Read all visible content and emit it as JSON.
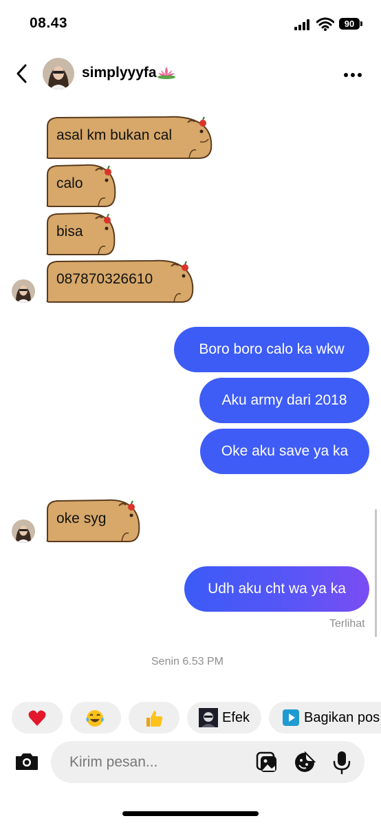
{
  "status_bar": {
    "time": "08.43",
    "battery": "90",
    "icons": [
      "cellular-signal-icon",
      "wifi-icon",
      "battery-icon"
    ]
  },
  "header": {
    "username": "simplyyyfa",
    "name_emoji": "lotus-icon",
    "icons": [
      "back-chevron-icon",
      "more-options-icon"
    ]
  },
  "messages": [
    {
      "from": "them",
      "text": "asal km bukan cal"
    },
    {
      "from": "them",
      "text": "calo"
    },
    {
      "from": "them",
      "text": "bisa"
    },
    {
      "from": "them",
      "text": "087870326610"
    },
    {
      "from": "me",
      "text": "Boro boro calo ka wkw"
    },
    {
      "from": "me",
      "text": "Aku army dari 2018"
    },
    {
      "from": "me",
      "text": "Oke aku save ya ka"
    },
    {
      "from": "them",
      "text": "oke syg"
    },
    {
      "from": "me",
      "text": "Udh aku cht wa ya ka"
    }
  ],
  "seen_label": "Terlihat",
  "timestamp": "Senin 6.53 PM",
  "quick_reactions": [
    {
      "icon": "red-heart-icon"
    },
    {
      "icon": "tears-of-joy-icon"
    },
    {
      "icon": "thumbs-up-icon"
    },
    {
      "icon": "effect-thumbnail",
      "label": "Efek"
    },
    {
      "icon": "play-share-icon",
      "label": "Bagikan pos"
    }
  ],
  "composer": {
    "placeholder": "Kirim pesan...",
    "icons": [
      "camera-icon",
      "gallery-icon",
      "sticker-icon",
      "microphone-icon"
    ]
  },
  "colors": {
    "sent_bubble_start": "#3b5bf7",
    "sent_bubble_end": "#7a4df4",
    "capybara_fill": "#d7a86a",
    "capybara_outline": "#5a3a1c"
  }
}
